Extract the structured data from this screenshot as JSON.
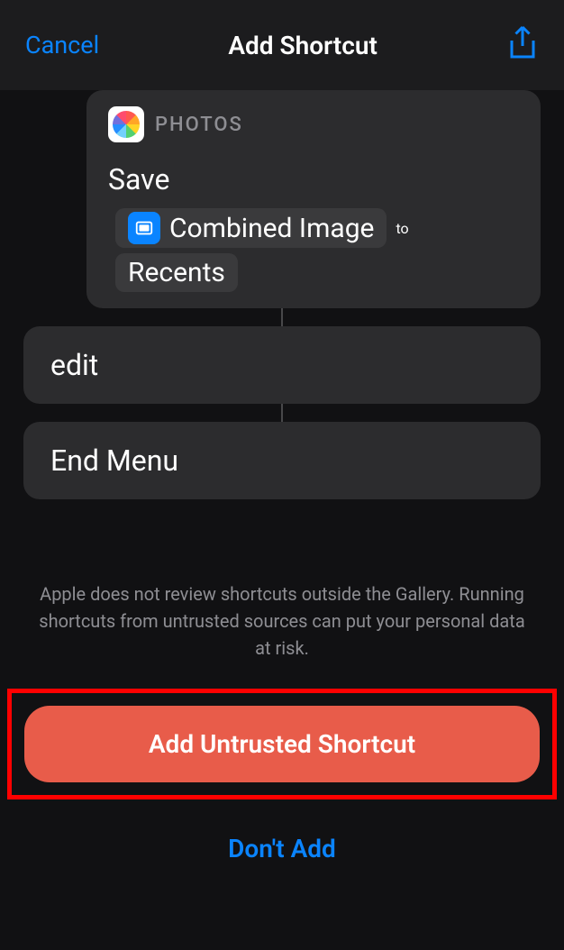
{
  "header": {
    "cancel_label": "Cancel",
    "title": "Add Shortcut"
  },
  "action": {
    "app_name": "PHOTOS",
    "verb": "Save",
    "param1_label": "Combined Image",
    "connector": "to",
    "param2_label": "Recents"
  },
  "edit_card": {
    "label": "edit"
  },
  "end_card": {
    "label": "End Menu"
  },
  "warning": "Apple does not review shortcuts outside the Gallery. Running shortcuts from untrusted sources can put your personal data at risk.",
  "buttons": {
    "primary_label": "Add Untrusted Shortcut",
    "secondary_label": "Don't Add"
  }
}
